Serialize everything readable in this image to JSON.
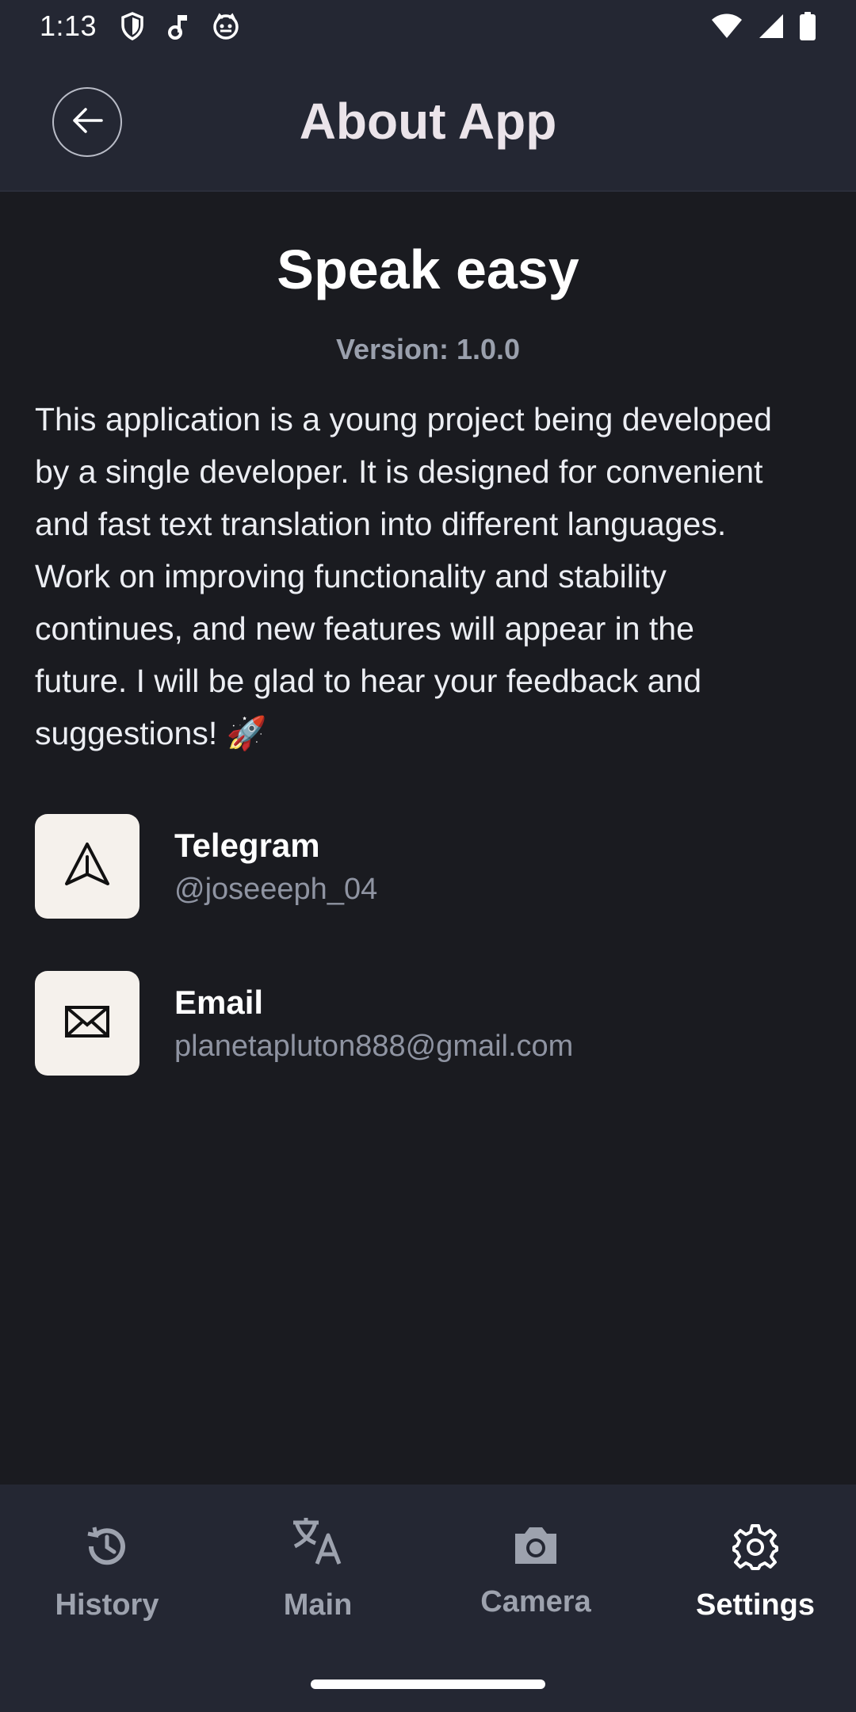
{
  "status_bar": {
    "time": "1:13",
    "left_icons": [
      "shield-icon",
      "music-note-icon",
      "cat-face-icon"
    ],
    "right_icons": [
      "wifi-icon",
      "cell-signal-icon",
      "battery-icon"
    ]
  },
  "app_bar": {
    "back_icon": "arrow-left-icon",
    "title": "About App"
  },
  "about": {
    "app_name": "Speak easy",
    "version": "Version: 1.0.0",
    "description_lines": [
      "This application is a young project being developed",
      "by a single developer. It is designed for convenient",
      "and fast text translation into different languages.",
      "Work on improving functionality and stability",
      "continues, and new features will appear in the",
      "future. I will be glad to hear your feedback and",
      "suggestions! 🚀"
    ]
  },
  "contacts": [
    {
      "icon": "send-icon",
      "title": "Telegram",
      "value": "@joseeeph_04"
    },
    {
      "icon": "mail-icon",
      "title": "Email",
      "value": "planetapluton888@gmail.com"
    }
  ],
  "bottom_nav": {
    "items": [
      {
        "icon": "history-icon",
        "label": "History",
        "active": false
      },
      {
        "icon": "translate-icon",
        "label": "Main",
        "active": false
      },
      {
        "icon": "camera-icon",
        "label": "Camera",
        "active": false
      },
      {
        "icon": "settings-gear-icon",
        "label": "Settings",
        "active": true
      }
    ]
  },
  "colors": {
    "background": "#1a1b20",
    "bar_background": "#242733",
    "icon_box": "#f5f1ec",
    "muted_text": "#8f94a2",
    "active_nav": "#ffffff",
    "inactive_nav": "#9da2ae"
  }
}
